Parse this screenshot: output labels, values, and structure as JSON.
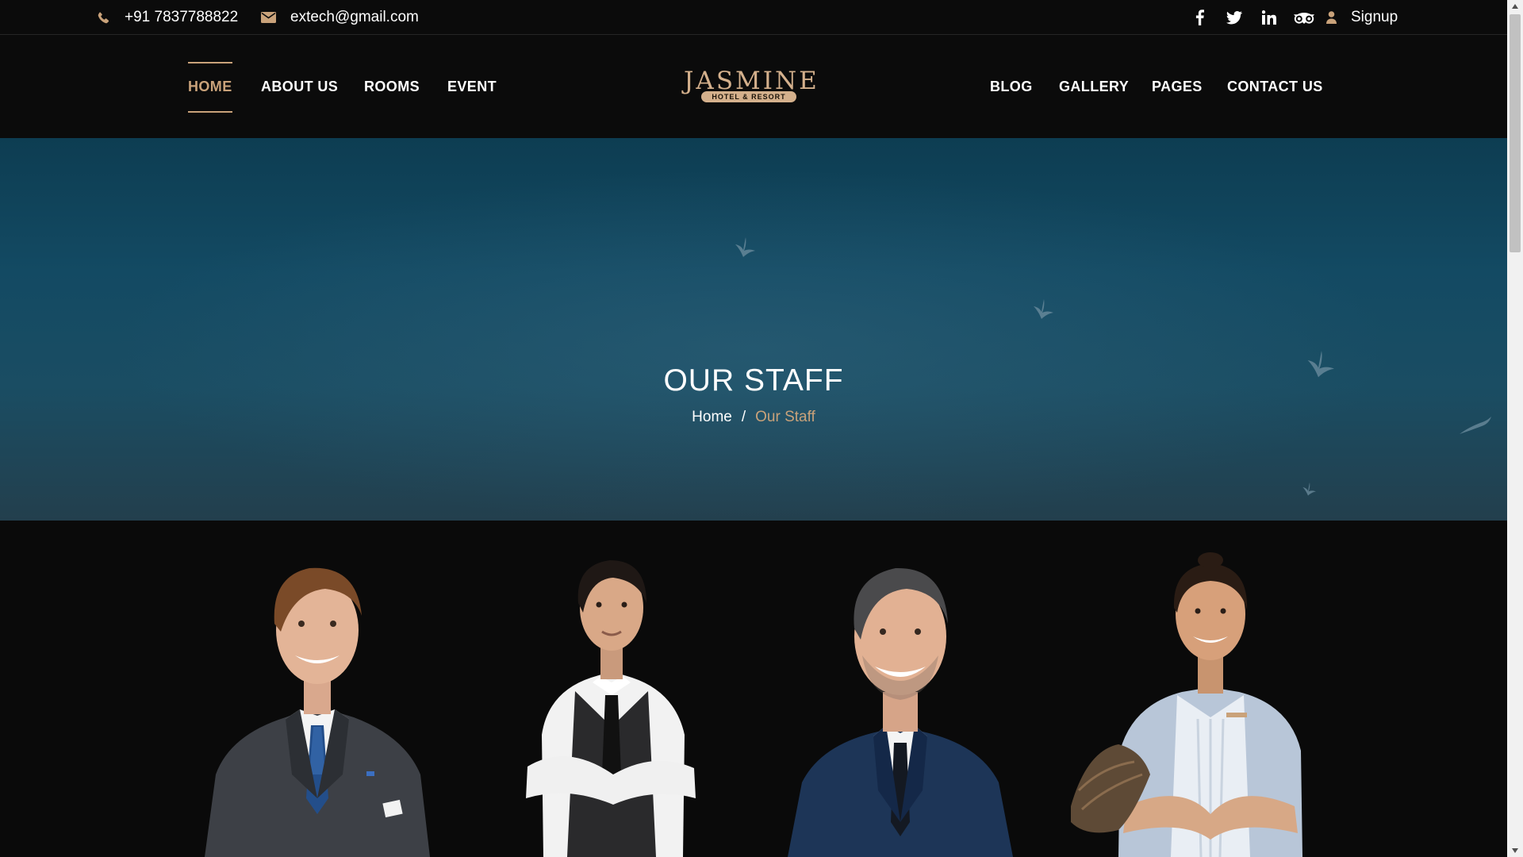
{
  "topbar": {
    "phone": "+91 7837788822",
    "email": "extech@gmail.com",
    "signup": "Signup",
    "social_icons": [
      "facebook-icon",
      "twitter-icon",
      "linkedin-icon",
      "tripadvisor-icon"
    ]
  },
  "nav": {
    "left": [
      "HOME",
      "ABOUT US",
      "ROOMS",
      "EVENT"
    ],
    "right": [
      "BLOG",
      "GALLERY",
      "PAGES",
      "CONTACT US"
    ],
    "active": "HOME"
  },
  "logo": {
    "name": "JASMINE",
    "tagline": "HOTEL & RESORT"
  },
  "hero": {
    "title": "OUR STAFF",
    "breadcrumb_home": "Home",
    "breadcrumb_separator": "/",
    "breadcrumb_current": "Our Staff"
  },
  "colors": {
    "accent": "#c9a27a",
    "background": "#0a0a0a",
    "hero": "#134a63"
  }
}
